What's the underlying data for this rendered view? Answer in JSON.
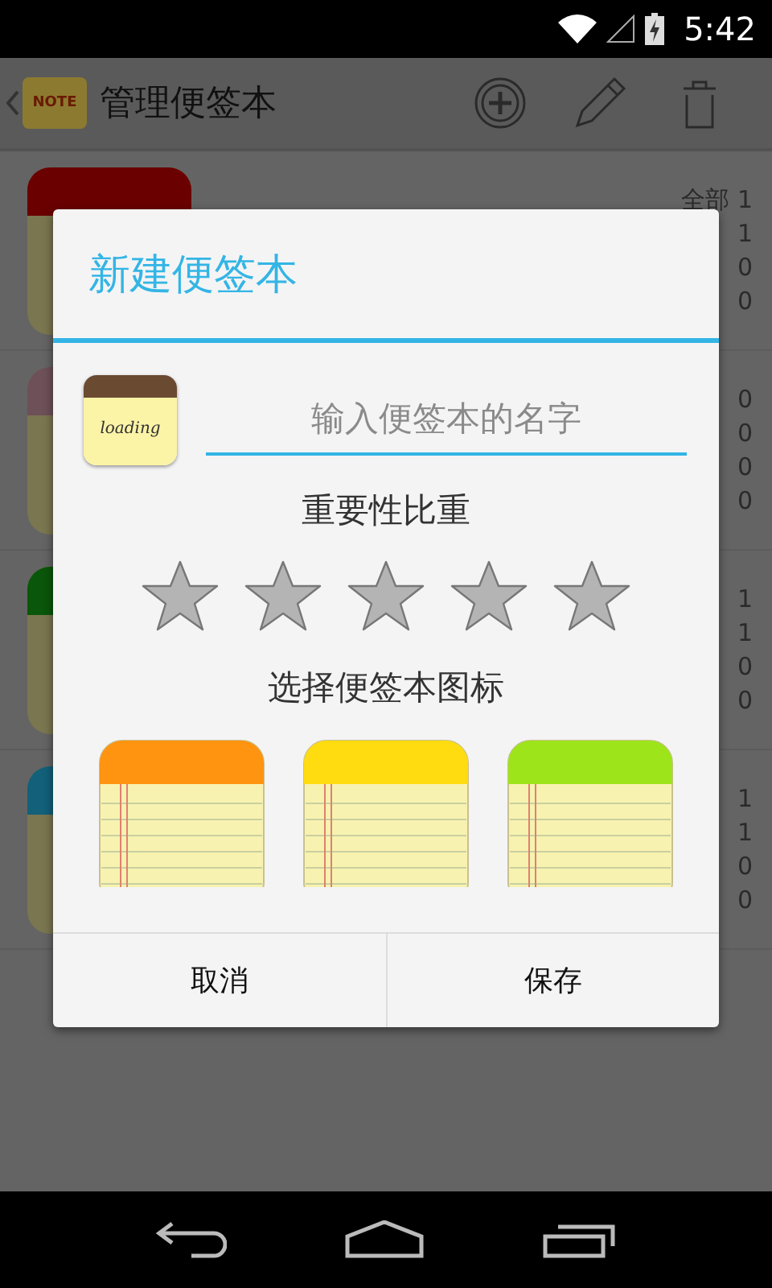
{
  "status_bar": {
    "time": "5:42"
  },
  "action_bar": {
    "logo_text": "NOTE",
    "title": "管理便签本"
  },
  "notebooks": [
    {
      "color": "#6a0000",
      "stats": [
        "全部 1",
        "1",
        "0",
        "0"
      ]
    },
    {
      "color": "#6e5058",
      "stats": [
        "0",
        "0",
        "0",
        "0"
      ]
    },
    {
      "color": "#0a560a",
      "stats": [
        "1",
        "1",
        "0",
        "0"
      ]
    },
    {
      "color": "#12607a",
      "stats": [
        "1",
        "1",
        "0",
        "0"
      ]
    }
  ],
  "dialog": {
    "title": "新建便签本",
    "preview_text": "loading",
    "name_field": {
      "placeholder": "输入便签本的名字"
    },
    "importance": {
      "label": "重要性比重",
      "stars": 0
    },
    "icon_picker": {
      "label": "选择便签本图标",
      "icons": [
        {
          "color": "#ff9410"
        },
        {
          "color": "#ffdc10"
        },
        {
          "color": "#9ee41a"
        }
      ]
    },
    "buttons": [
      "取消",
      "保存"
    ]
  }
}
